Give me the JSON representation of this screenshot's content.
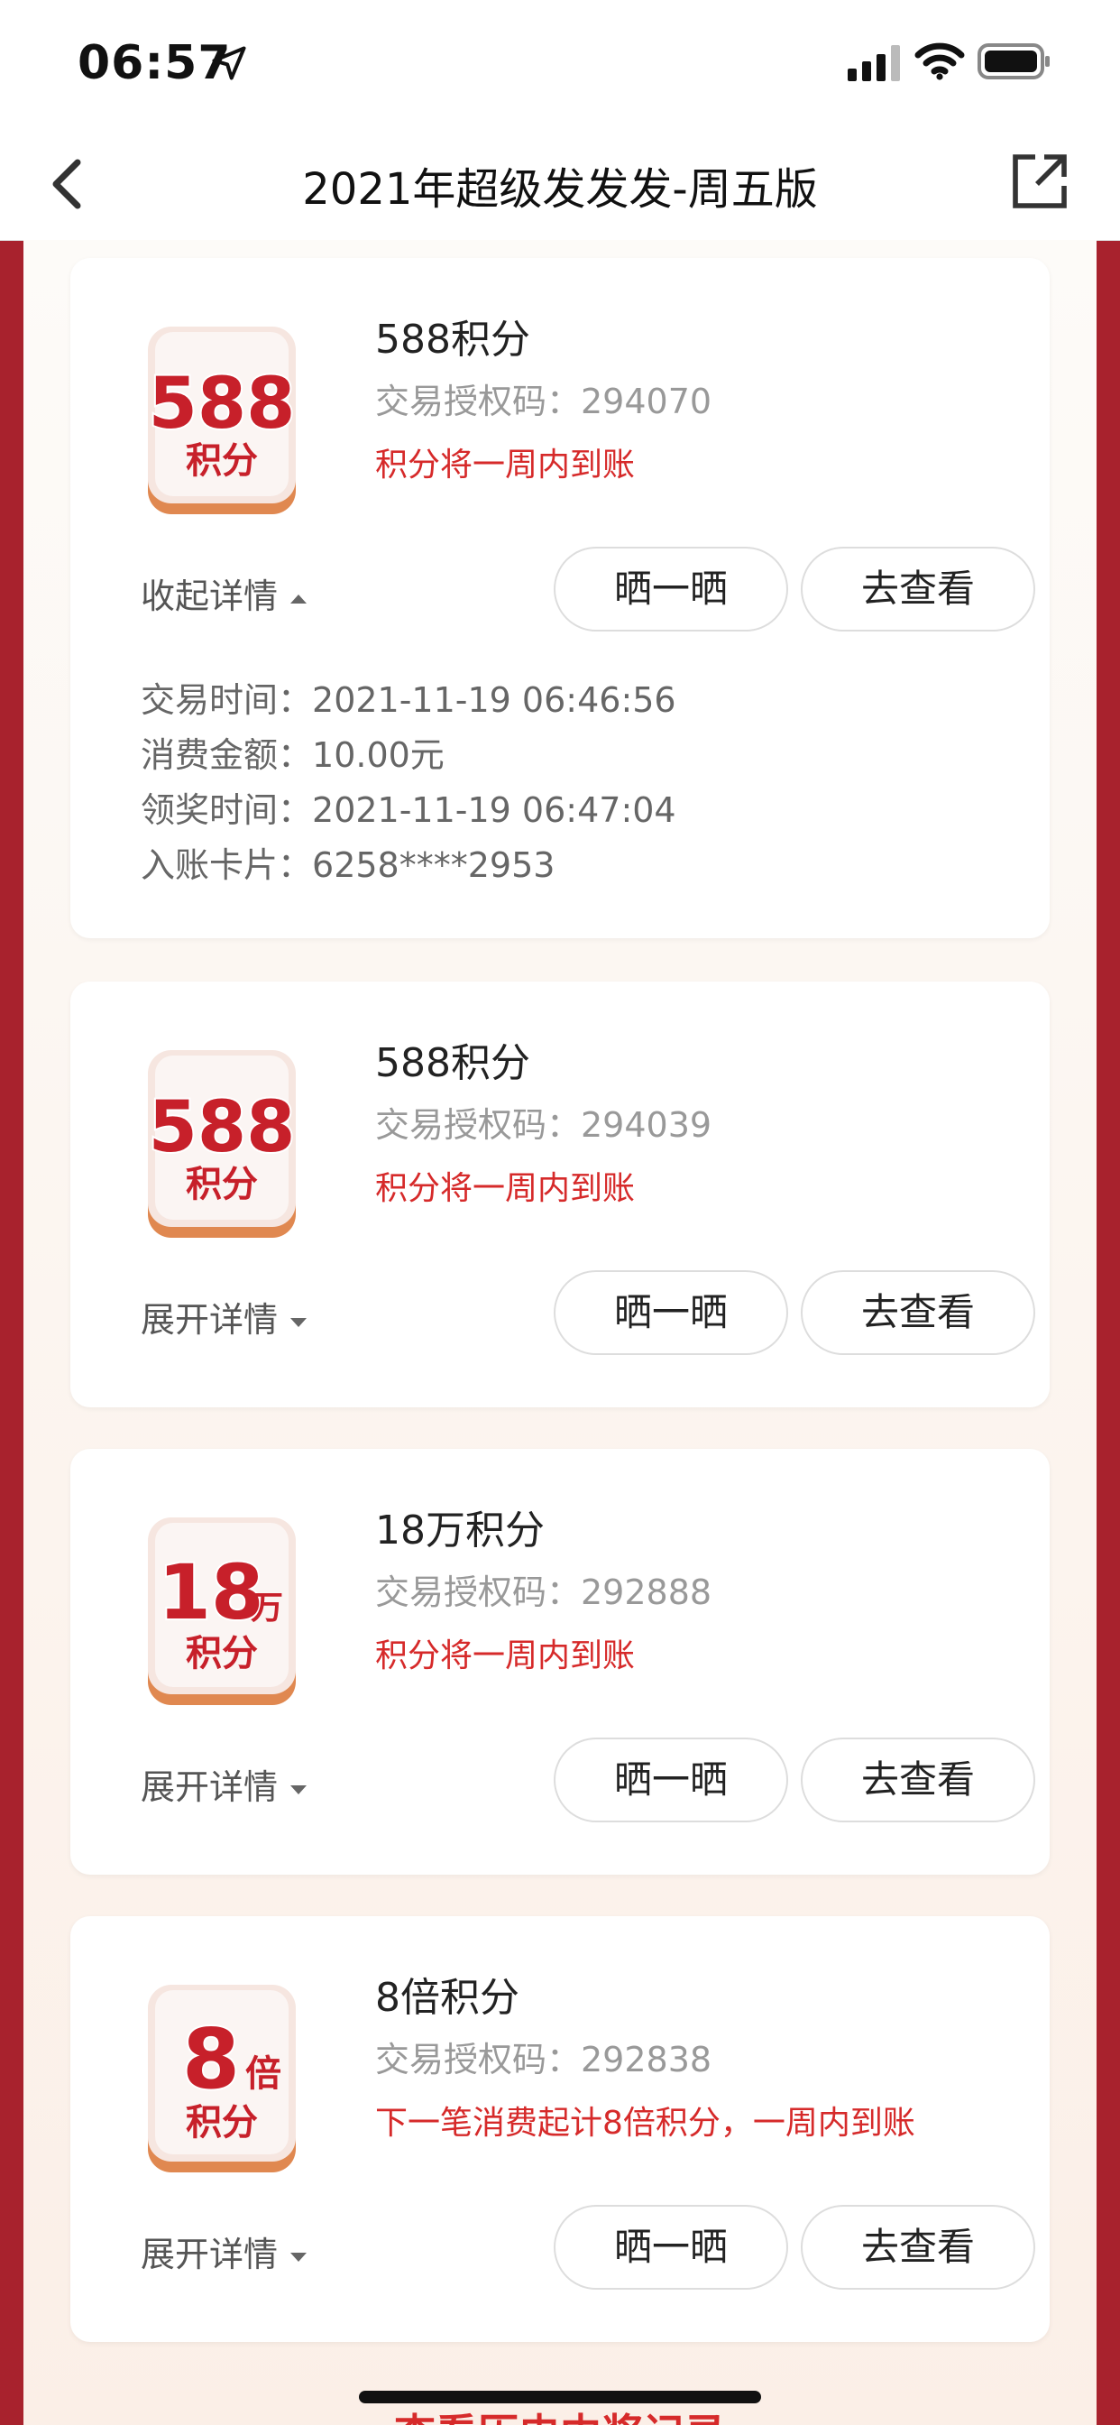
{
  "status": {
    "time": "06:57"
  },
  "nav": {
    "title": "2021年超级发发发-周五版"
  },
  "cards": [
    {
      "badge_big": "588",
      "badge_sub": "积分",
      "badge_suffix": "",
      "title": "588积分",
      "code": "交易授权码：294070",
      "note": "积分将一周内到账",
      "toggle": "收起详情",
      "share": "晒一晒",
      "view": "去查看",
      "details": [
        {
          "label": "交易时间：",
          "value": "2021-11-19 06:46:56"
        },
        {
          "label": "消费金额：",
          "value": "10.00元"
        },
        {
          "label": "领奖时间：",
          "value": "2021-11-19 06:47:04"
        },
        {
          "label": "入账卡片：",
          "value": "6258****2953"
        }
      ]
    },
    {
      "badge_big": "588",
      "badge_sub": "积分",
      "badge_suffix": "",
      "title": "588积分",
      "code": "交易授权码：294039",
      "note": "积分将一周内到账",
      "toggle": "展开详情",
      "share": "晒一晒",
      "view": "去查看"
    },
    {
      "badge_big": "18",
      "badge_sub": "积分",
      "badge_suffix": "万",
      "title": "18万积分",
      "code": "交易授权码：292888",
      "note": "积分将一周内到账",
      "toggle": "展开详情",
      "share": "晒一晒",
      "view": "去查看"
    },
    {
      "badge_big": "8",
      "badge_sub": "积分",
      "badge_suffix": "倍",
      "title": "8倍积分",
      "code": "交易授权码：292838",
      "note": "下一笔消费起计8倍积分，一周内到账",
      "toggle": "展开详情",
      "share": "晒一晒",
      "view": "去查看"
    }
  ],
  "bottom_link": "查看历史中奖记录"
}
